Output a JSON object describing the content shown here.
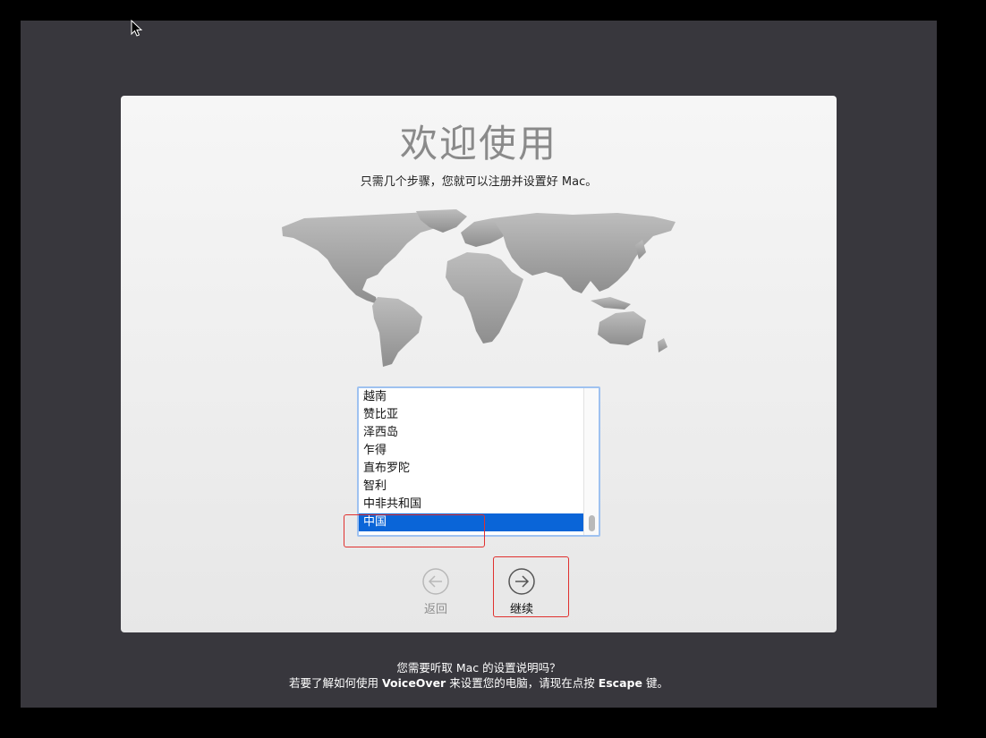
{
  "setup": {
    "title": "欢迎使用",
    "subtitle": "只需几个步骤，您就可以注册并设置好 Mac。",
    "countries": [
      "越南",
      "赞比亚",
      "泽西岛",
      "乍得",
      "直布罗陀",
      "智利",
      "中非共和国",
      "中国"
    ],
    "selected_country": "中国",
    "back_label": "返回",
    "continue_label": "继续"
  },
  "voiceover_hint": {
    "line1": "您需要听取 Mac 的设置说明吗？",
    "line2_before": "若要了解如何使用",
    "line2_voiceover": "VoiceOver",
    "line2_mid": "来设置您的电脑，请现在点按",
    "line2_escape": "Escape",
    "line2_after": "键。"
  },
  "colors": {
    "selection": "#0a65d8",
    "highlight": "#e0312f",
    "screen_bg": "#38373d"
  },
  "icons": {
    "back": "arrow-left-circle-icon",
    "continue": "arrow-right-circle-icon",
    "cursor": "mouse-pointer-icon"
  }
}
